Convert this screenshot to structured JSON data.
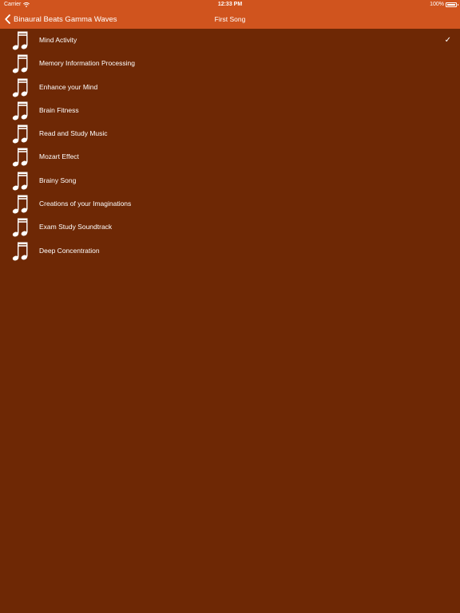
{
  "status_bar": {
    "carrier": "Carrier",
    "time": "12:33 PM",
    "battery": "100%"
  },
  "nav": {
    "back_label": "Binaural Beats Gamma Waves",
    "title": "First Song"
  },
  "songs": [
    {
      "title": "Mind Activity",
      "selected": true
    },
    {
      "title": "Memory Information Processing",
      "selected": false
    },
    {
      "title": "Enhance your Mind",
      "selected": false
    },
    {
      "title": "Brain Fitness",
      "selected": false
    },
    {
      "title": "Read and Study Music",
      "selected": false
    },
    {
      "title": "Mozart Effect",
      "selected": false
    },
    {
      "title": "Brainy Song",
      "selected": false
    },
    {
      "title": "Creations of your Imaginations",
      "selected": false
    },
    {
      "title": "Exam Study Soundtrack",
      "selected": false
    },
    {
      "title": "Deep Concentration",
      "selected": false
    }
  ],
  "check_mark": "✓",
  "colors": {
    "bar": "#d0541e",
    "background": "#6e2805",
    "text": "#ffffff"
  },
  "icons": {
    "row": "music-note-icon",
    "back": "chevron-left-icon",
    "wifi": "wifi-icon",
    "battery": "battery-icon",
    "selected": "checkmark-icon"
  }
}
